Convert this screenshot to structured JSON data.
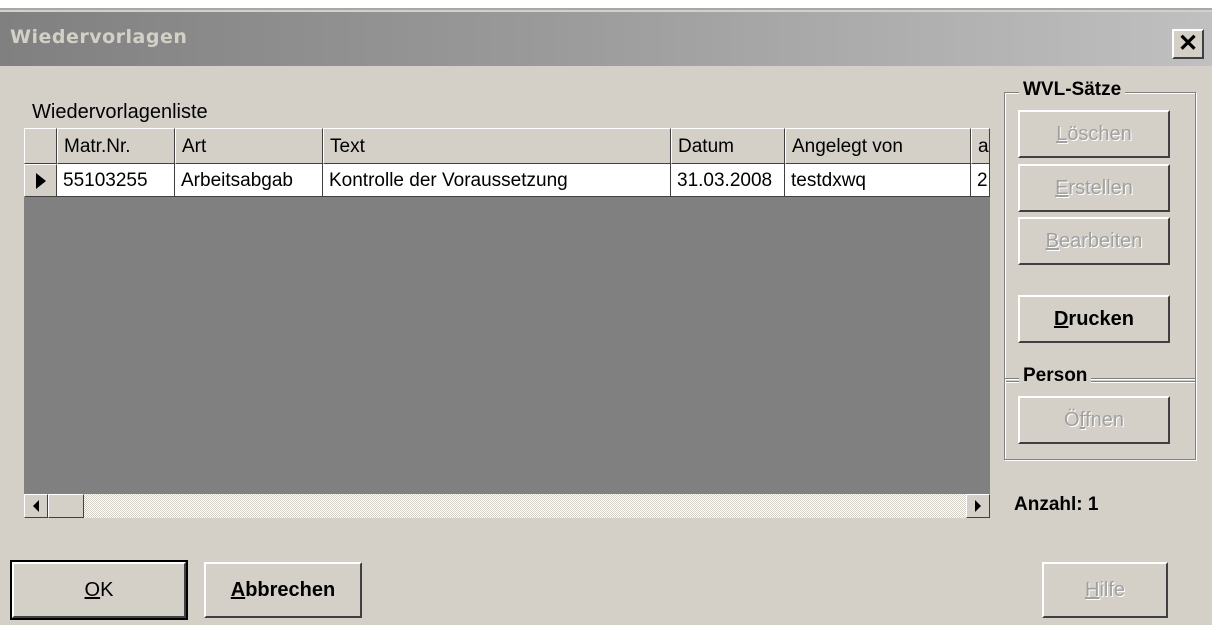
{
  "window": {
    "title": "Wiedervorlagen",
    "close_label": "✕"
  },
  "grid": {
    "caption": "Wiedervorlagenliste",
    "columns": [
      "Matr.Nr.",
      "Art",
      "Text",
      "Datum",
      "Angelegt von",
      "a"
    ],
    "rows": [
      {
        "matr": "55103255",
        "art": "Arbeitsabgab",
        "text": "Kontrolle der Voraussetzung",
        "datum": "31.03.2008",
        "angelegt": "testdxwq",
        "a": "2"
      }
    ],
    "row_indicator_icon": "arrow-right-icon"
  },
  "wvl_group": {
    "legend": "WVL-Sätze",
    "loeschen": {
      "first": "L",
      "rest": "öschen"
    },
    "erstellen": {
      "first": "E",
      "rest": "rstellen"
    },
    "bearbeiten": {
      "first": "B",
      "rest": "earbeiten"
    },
    "drucken": {
      "first": "D",
      "rest": "rucken"
    }
  },
  "person_group": {
    "legend": "Person",
    "oeffnen": {
      "pre": "Ö",
      "u": "f",
      "rest": "fnen"
    }
  },
  "count_label": "Anzahl: 1",
  "footer": {
    "ok": {
      "first": "O",
      "rest": "K"
    },
    "abbrechen": {
      "first": "A",
      "rest": "bbrechen"
    },
    "hilfe": {
      "first": "H",
      "rest": "ilfe"
    }
  },
  "colors": {
    "face": "#d4d0c8",
    "grid_bg": "#808080",
    "disabled_text": "#a0a0a0"
  }
}
